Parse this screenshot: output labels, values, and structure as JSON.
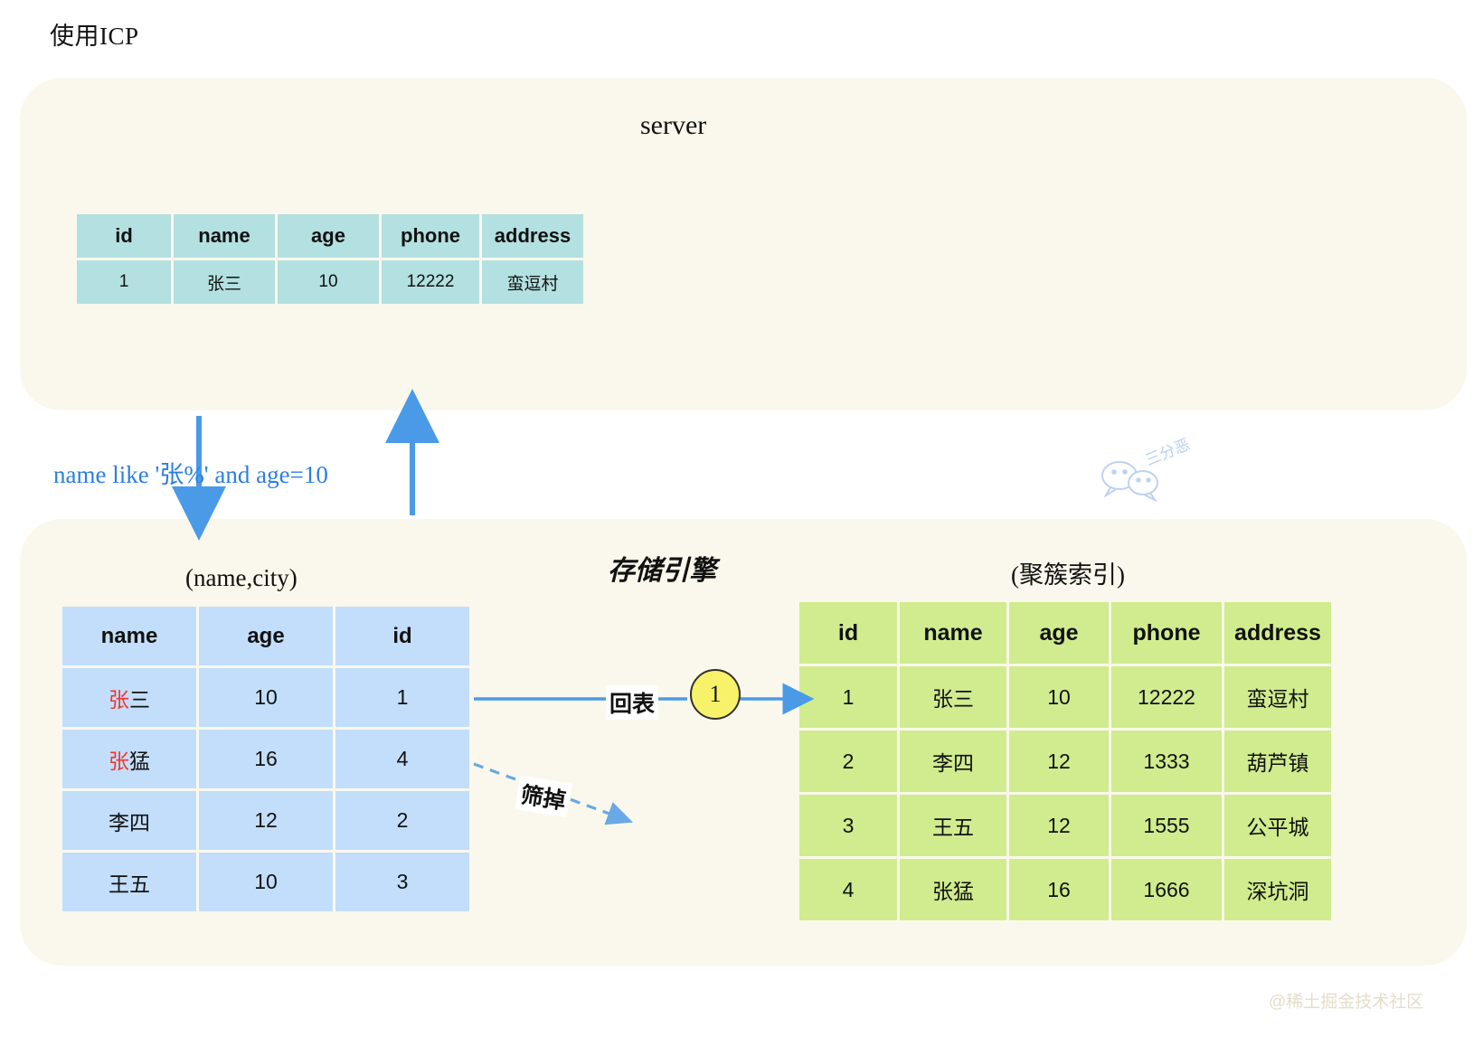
{
  "title": "使用ICP",
  "colors": {
    "panel_bg": "#faf8ec",
    "server_table": "#b3e0e0",
    "index_table": "#c3defa",
    "clustered_table": "#d0ec8e",
    "arrow_blue": "#4a9ae8",
    "highlight_red": "#f2352b",
    "highlight_blue": "#3333d6",
    "badge_yellow": "#f7f26a"
  },
  "server": {
    "heading": "server",
    "table": {
      "columns": [
        "id",
        "name",
        "age",
        "phone",
        "address"
      ],
      "rows": [
        [
          "1",
          "张三",
          "10",
          "12222",
          "蛮逗村"
        ]
      ]
    }
  },
  "connectors": {
    "query_label": "name like '张%' and age=10",
    "lookup_label": "回表",
    "filtered_label": "筛掉",
    "step_badge": "1"
  },
  "engine": {
    "heading": "存储引擎",
    "index_table": {
      "caption": "(name,city)",
      "columns": [
        "name",
        "age",
        "id"
      ],
      "rows": [
        {
          "name_hl": "张",
          "name_rest": "三",
          "age": "10",
          "id": "1",
          "age_color": "red",
          "id_color": "red"
        },
        {
          "name_hl": "张",
          "name_rest": "猛",
          "age": "16",
          "id": "4",
          "age_color": "red",
          "id_color": "blue"
        },
        {
          "name_hl": "",
          "name_rest": "李四",
          "age": "12",
          "id": "2",
          "age_color": "black",
          "id_color": "black"
        },
        {
          "name_hl": "",
          "name_rest": "王五",
          "age": "10",
          "id": "3",
          "age_color": "black",
          "id_color": "black"
        }
      ]
    },
    "clustered_table": {
      "caption": "(聚簇索引)",
      "columns": [
        "id",
        "name",
        "age",
        "phone",
        "address"
      ],
      "rows": [
        {
          "id": "1",
          "id_color": "red",
          "name": "张三",
          "age": "10",
          "phone": "12222",
          "address": "蛮逗村"
        },
        {
          "id": "2",
          "id_color": "black",
          "name": "李四",
          "age": "12",
          "phone": "1333",
          "address": "葫芦镇"
        },
        {
          "id": "3",
          "id_color": "black",
          "name": "王五",
          "age": "12",
          "phone": "1555",
          "address": "公平城"
        },
        {
          "id": "4",
          "id_color": "black",
          "name": "张猛",
          "age": "16",
          "phone": "1666",
          "address": "深坑洞"
        }
      ]
    }
  },
  "watermarks": {
    "wechat": "三分恶",
    "site": "@稀土掘金技术社区"
  }
}
